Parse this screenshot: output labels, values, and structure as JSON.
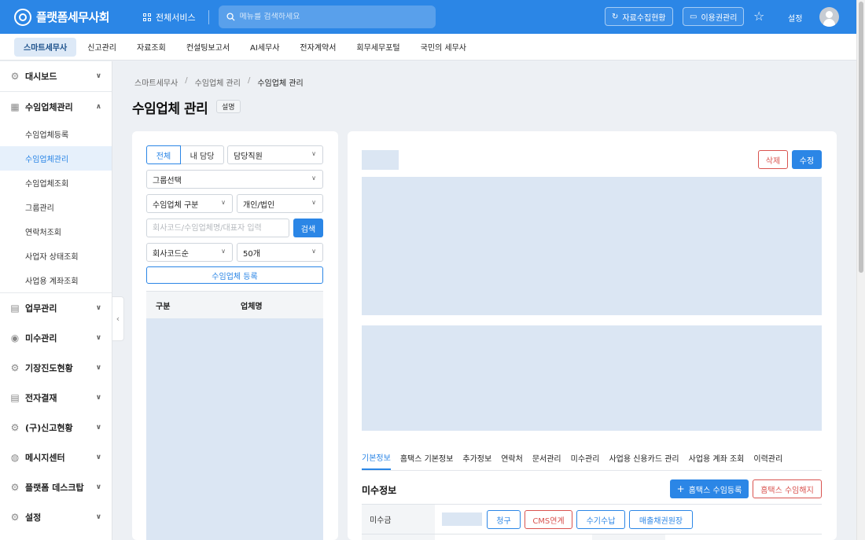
{
  "header": {
    "logo_text": "플랫폼세무사회",
    "all_services": "전체서비스",
    "search_placeholder": "메뉴를 검색하세요",
    "collect_status": "자료수집현황",
    "license_mgmt": "이용권관리",
    "settings": "설정"
  },
  "menubar": {
    "items": [
      "스마트세무사",
      "신고관리",
      "자료조회",
      "컨설팅보고서",
      "AI세무사",
      "전자계약서",
      "회무세무포털",
      "국민의 세무사"
    ]
  },
  "sidebar": {
    "dashboard": "대시보드",
    "client_mgmt": "수임업체관리",
    "sub_items": [
      "수임업체등록",
      "수임업체관리",
      "수임업체조회",
      "그룹관리",
      "연락처조회",
      "사업자 상태조회",
      "사업용 계좌조회"
    ],
    "groups": [
      "업무관리",
      "미수관리",
      "기장진도현황",
      "전자결재",
      "(구)신고현황",
      "메시지센터",
      "플랫폼 데스크탑",
      "설정"
    ]
  },
  "breadcrumb": [
    "스마트세무사",
    "수임업체 관리",
    "수임업체 관리"
  ],
  "page": {
    "title": "수임업체 관리",
    "desc_badge": "설명"
  },
  "filters": {
    "seg_all": "전체",
    "seg_mine": "내 담당",
    "staff_select": "담당직원",
    "group_select": "그룹선택",
    "client_type": "수임업체 구분",
    "entity_type": "개인/법인",
    "search_placeholder": "회사코드/수임업체명/대표자 입력",
    "search_btn": "검색",
    "sort_select": "회사코드순",
    "page_size": "50개",
    "register_btn": "수임업체 등록"
  },
  "list": {
    "col_type": "구분",
    "col_name": "업체명"
  },
  "detail": {
    "delete_btn": "삭제",
    "edit_btn": "수정",
    "tabs": [
      "기본정보",
      "홈택스 기본정보",
      "추가정보",
      "연락처",
      "문서관리",
      "미수관리",
      "사업용 신용카드 관리",
      "사업용 계좌 조회",
      "이력관리"
    ],
    "section_title": "미수정보",
    "hometax_register": "홈택스 수임등록",
    "hometax_cancel": "홈택스 수임해지",
    "row_label": "미수금",
    "btn_bill": "청구",
    "btn_cms": "CMS연계",
    "btn_manual": "수기수납",
    "btn_ledger": "매출채권원장"
  }
}
